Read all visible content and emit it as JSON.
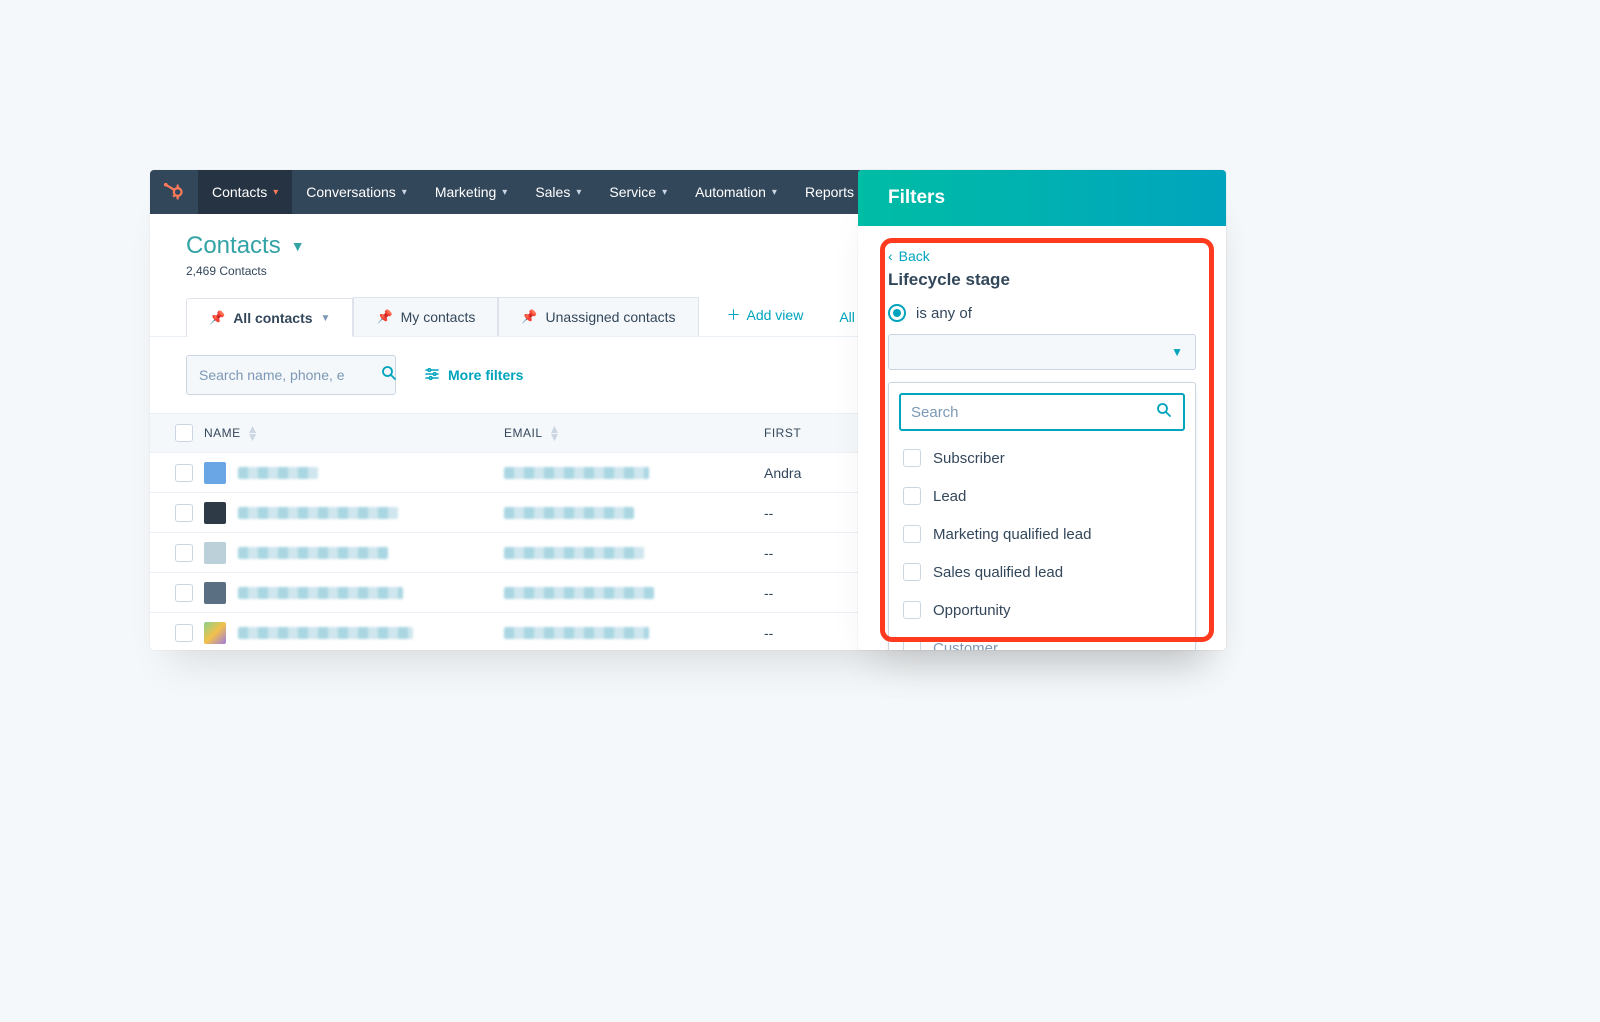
{
  "nav": {
    "items": [
      {
        "label": "Contacts",
        "active": true
      },
      {
        "label": "Conversations",
        "active": false
      },
      {
        "label": "Marketing",
        "active": false
      },
      {
        "label": "Sales",
        "active": false
      },
      {
        "label": "Service",
        "active": false
      },
      {
        "label": "Automation",
        "active": false
      },
      {
        "label": "Reports",
        "active": false
      }
    ]
  },
  "header": {
    "title": "Contacts",
    "subtitle": "2,469 Contacts"
  },
  "tabs": {
    "items": [
      {
        "label": "All contacts",
        "active": true,
        "caret": true
      },
      {
        "label": "My contacts",
        "active": false,
        "caret": false
      },
      {
        "label": "Unassigned contacts",
        "active": false,
        "caret": false
      }
    ],
    "add_view": "Add view",
    "all_views": "All views"
  },
  "tools": {
    "search_placeholder": "Search name, phone, e",
    "more_filters": "More filters"
  },
  "table": {
    "columns": {
      "name": "NAME",
      "email": "EMAIL",
      "first": "FIRST"
    },
    "rows": [
      {
        "avatar": "#6aa6e6",
        "name_w": 80,
        "email_w": 145,
        "first": "Andra"
      },
      {
        "avatar": "#2e3a46",
        "name_w": 160,
        "email_w": 130,
        "first": "--"
      },
      {
        "avatar": "#bcd0d9",
        "name_w": 150,
        "email_w": 140,
        "first": "--"
      },
      {
        "avatar": "#5a6f82",
        "name_w": 165,
        "email_w": 150,
        "first": "--"
      },
      {
        "avatar": "linear-gradient(135deg,#8ad28a,#f3c04b 50%,#9f7be0)",
        "name_w": 175,
        "email_w": 145,
        "first": "--"
      }
    ]
  },
  "filters": {
    "panel_title": "Filters",
    "back": "Back",
    "filter_name": "Lifecycle stage",
    "operator": "is any of",
    "search_placeholder": "Search",
    "options": [
      {
        "label": "Subscriber"
      },
      {
        "label": "Lead"
      },
      {
        "label": "Marketing qualified lead"
      },
      {
        "label": "Sales qualified lead"
      },
      {
        "label": "Opportunity"
      },
      {
        "label": "Customer"
      }
    ]
  }
}
